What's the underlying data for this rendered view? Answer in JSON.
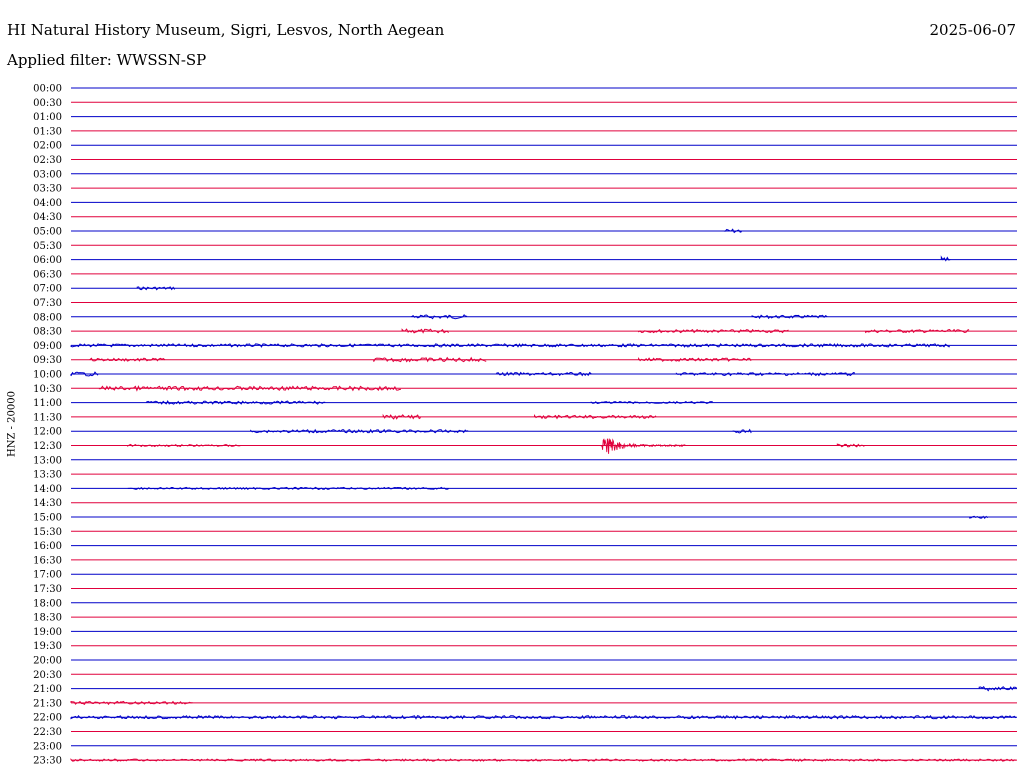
{
  "header": {
    "station": "HI Natural History Museum, Sigri, Lesvos, North Aegean",
    "date": "2025-06-07",
    "filter": "Applied filter: WWSSN-SP",
    "channel": "HNZ - 20000"
  },
  "colors": {
    "blue_trace": "#0000c8",
    "red_trace": "#e0003c"
  },
  "chart_data": {
    "type": "line",
    "title": "HI Natural History Museum, Sigri, Lesvos, North Aegean",
    "ylabel": "HNZ - 20000",
    "rows": [
      {
        "label": "00:00",
        "color": "blue"
      },
      {
        "label": "00:30",
        "color": "red"
      },
      {
        "label": "01:00",
        "color": "blue"
      },
      {
        "label": "01:30",
        "color": "red"
      },
      {
        "label": "02:00",
        "color": "blue"
      },
      {
        "label": "02:30",
        "color": "red"
      },
      {
        "label": "03:00",
        "color": "blue"
      },
      {
        "label": "03:30",
        "color": "red"
      },
      {
        "label": "04:00",
        "color": "blue"
      },
      {
        "label": "04:30",
        "color": "red"
      },
      {
        "label": "05:00",
        "color": "blue"
      },
      {
        "label": "05:30",
        "color": "red"
      },
      {
        "label": "06:00",
        "color": "blue"
      },
      {
        "label": "06:30",
        "color": "red"
      },
      {
        "label": "07:00",
        "color": "blue"
      },
      {
        "label": "07:30",
        "color": "red"
      },
      {
        "label": "08:00",
        "color": "blue"
      },
      {
        "label": "08:30",
        "color": "red"
      },
      {
        "label": "09:00",
        "color": "blue"
      },
      {
        "label": "09:30",
        "color": "red"
      },
      {
        "label": "10:00",
        "color": "blue"
      },
      {
        "label": "10:30",
        "color": "red"
      },
      {
        "label": "11:00",
        "color": "blue"
      },
      {
        "label": "11:30",
        "color": "red"
      },
      {
        "label": "12:00",
        "color": "blue"
      },
      {
        "label": "12:30",
        "color": "red"
      },
      {
        "label": "13:00",
        "color": "blue"
      },
      {
        "label": "13:30",
        "color": "red"
      },
      {
        "label": "14:00",
        "color": "blue"
      },
      {
        "label": "14:30",
        "color": "red"
      },
      {
        "label": "15:00",
        "color": "blue"
      },
      {
        "label": "15:30",
        "color": "red"
      },
      {
        "label": "16:00",
        "color": "blue"
      },
      {
        "label": "16:30",
        "color": "red"
      },
      {
        "label": "17:00",
        "color": "blue"
      },
      {
        "label": "17:30",
        "color": "red"
      },
      {
        "label": "18:00",
        "color": "blue"
      },
      {
        "label": "18:30",
        "color": "red"
      },
      {
        "label": "19:00",
        "color": "blue"
      },
      {
        "label": "19:30",
        "color": "red"
      },
      {
        "label": "20:00",
        "color": "blue"
      },
      {
        "label": "20:30",
        "color": "red"
      },
      {
        "label": "21:00",
        "color": "blue"
      },
      {
        "label": "21:30",
        "color": "red"
      },
      {
        "label": "22:00",
        "color": "blue"
      },
      {
        "label": "22:30",
        "color": "red"
      },
      {
        "label": "23:00",
        "color": "blue"
      },
      {
        "label": "23:30",
        "color": "red"
      }
    ],
    "events": [
      {
        "row": 10,
        "start": 0.69,
        "end": 0.71,
        "amp": 2
      },
      {
        "row": 12,
        "start": 0.92,
        "end": 0.93,
        "amp": 3
      },
      {
        "row": 14,
        "start": 0.07,
        "end": 0.11,
        "amp": 1.5
      },
      {
        "row": 16,
        "start": 0.36,
        "end": 0.42,
        "amp": 2
      },
      {
        "row": 16,
        "start": 0.72,
        "end": 0.8,
        "amp": 1.5
      },
      {
        "row": 17,
        "start": 0.35,
        "end": 0.4,
        "amp": 2
      },
      {
        "row": 17,
        "start": 0.6,
        "end": 0.76,
        "amp": 1.5
      },
      {
        "row": 17,
        "start": 0.84,
        "end": 0.95,
        "amp": 1.5
      },
      {
        "row": 18,
        "start": 0.0,
        "end": 0.93,
        "amp": 1.5
      },
      {
        "row": 19,
        "start": 0.02,
        "end": 0.1,
        "amp": 1.5
      },
      {
        "row": 19,
        "start": 0.32,
        "end": 0.44,
        "amp": 2
      },
      {
        "row": 19,
        "start": 0.6,
        "end": 0.72,
        "amp": 1.5
      },
      {
        "row": 20,
        "start": 0.0,
        "end": 0.03,
        "amp": 2
      },
      {
        "row": 20,
        "start": 0.45,
        "end": 0.55,
        "amp": 1.5
      },
      {
        "row": 20,
        "start": 0.64,
        "end": 0.83,
        "amp": 1.5
      },
      {
        "row": 21,
        "start": 0.03,
        "end": 0.35,
        "amp": 2
      },
      {
        "row": 22,
        "start": 0.08,
        "end": 0.27,
        "amp": 1.5
      },
      {
        "row": 22,
        "start": 0.55,
        "end": 0.68,
        "amp": 1
      },
      {
        "row": 23,
        "start": 0.33,
        "end": 0.37,
        "amp": 2
      },
      {
        "row": 23,
        "start": 0.49,
        "end": 0.62,
        "amp": 1.5
      },
      {
        "row": 24,
        "start": 0.19,
        "end": 0.42,
        "amp": 1.5
      },
      {
        "row": 24,
        "start": 0.7,
        "end": 0.72,
        "amp": 2
      },
      {
        "row": 25,
        "start": 0.06,
        "end": 0.18,
        "amp": 1
      },
      {
        "row": 25,
        "start": 0.56,
        "end": 0.65,
        "amp": 16
      },
      {
        "row": 25,
        "start": 0.81,
        "end": 0.84,
        "amp": 1.5
      },
      {
        "row": 28,
        "start": 0.06,
        "end": 0.4,
        "amp": 1
      },
      {
        "row": 30,
        "start": 0.95,
        "end": 0.97,
        "amp": 1.5
      },
      {
        "row": 42,
        "start": 0.96,
        "end": 1.0,
        "amp": 2
      },
      {
        "row": 43,
        "start": 0.0,
        "end": 0.13,
        "amp": 1.5
      },
      {
        "row": 44,
        "start": 0.0,
        "end": 1.0,
        "amp": 1.5
      },
      {
        "row": 47,
        "start": 0.0,
        "end": 1.0,
        "amp": 1
      }
    ]
  }
}
